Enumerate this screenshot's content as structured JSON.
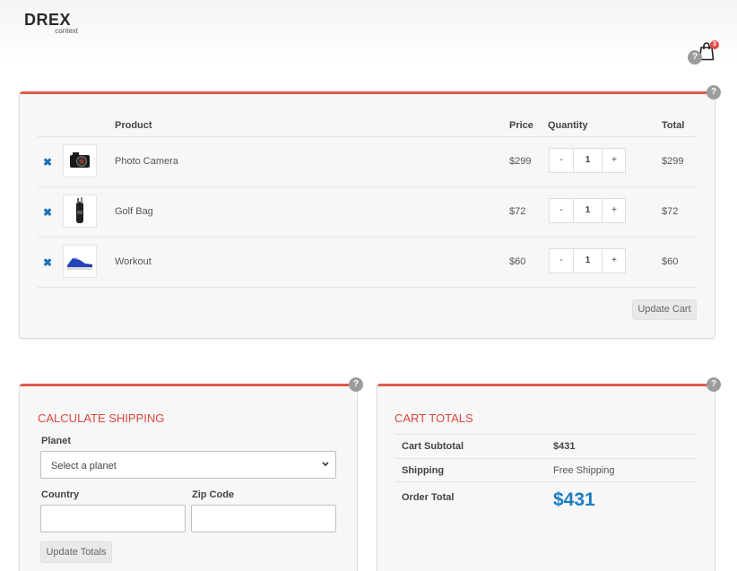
{
  "brand": {
    "name": "DREX",
    "tagline": "context"
  },
  "header": {
    "cart_count": "3",
    "help": "?",
    "cart_icon": "shopping-bag-icon"
  },
  "cart": {
    "columns": {
      "product": "Product",
      "price": "Price",
      "quantity": "Quantity",
      "total": "Total"
    },
    "remove_symbol": "✖",
    "items": [
      {
        "name": "Photo Camera",
        "price": "$299",
        "qty": "1",
        "total": "$299",
        "minus": "-",
        "plus": "+",
        "icon": "camera-image"
      },
      {
        "name": "Golf Bag",
        "price": "$72",
        "qty": "1",
        "total": "$72",
        "minus": "-",
        "plus": "+",
        "icon": "golf-bag-image"
      },
      {
        "name": "Workout",
        "price": "$60",
        "qty": "1",
        "total": "$60",
        "minus": "-",
        "plus": "+",
        "icon": "sneaker-image"
      }
    ],
    "update_button": "Update Cart"
  },
  "shipping": {
    "title": "CALCULATE SHIPPING",
    "planet_label": "Planet",
    "planet_value": "Select a planet",
    "country_label": "Country",
    "country_value": "",
    "zip_label": "Zip Code",
    "zip_value": "",
    "update_button": "Update Totals"
  },
  "totals": {
    "title": "CART TOTALS",
    "subtotal_label": "Cart Subtotal",
    "subtotal_value": "$431",
    "shipping_label": "Shipping",
    "shipping_value": "Free Shipping",
    "order_label": "Order Total",
    "order_value": "$431"
  },
  "colors": {
    "accent": "#e05a4e",
    "total_blue": "#1b7cc2",
    "remove_blue": "#1b6fb5",
    "badge": "#e24b4b"
  }
}
